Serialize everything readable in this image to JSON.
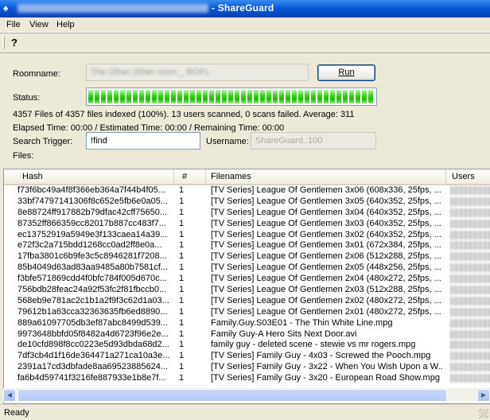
{
  "window": {
    "title": "- ShareGuard"
  },
  "menu": {
    "file": "File",
    "view": "View",
    "help": "Help"
  },
  "toolbar": {
    "help_glyph": "?"
  },
  "form": {
    "roomname_label": "Roomname:",
    "run_label": "Run",
    "status_label": "Status:",
    "progress": 1.0,
    "summary": "4357 Files of 4357 files indexed (100%). 13 users scanned, 0 scans failed. Average: 311",
    "elapsed": "Elapsed Time: 00:00 / Estimated Time: 00:00 / Remaining Time: 00:00",
    "search_trigger_label": "Search Trigger:",
    "search_trigger_value": "!find",
    "username_label": "Username:",
    "username_value": "ShareGuard..100",
    "files_label": "Files:"
  },
  "table": {
    "columns": [
      "Hash",
      "#",
      "Filenames",
      "Users"
    ],
    "rows": [
      {
        "hash": "f73f6bc49a4f8f366eb364a7f44b4f05...",
        "count": "1",
        "filename": "[TV Series] League Of Gentlemen 3x06 (608x336, 25fps, ..."
      },
      {
        "hash": "33bf74797141306f8c652e5fb6e0a05...",
        "count": "1",
        "filename": "[TV Series] League Of Gentlemen 3x05 (640x352, 25fps, ..."
      },
      {
        "hash": "8e88724ff917882b79dfac42cff75650...",
        "count": "1",
        "filename": "[TV Series] League Of Gentlemen 3x04 (640x352, 25fps, ..."
      },
      {
        "hash": "87352ff866359cc82017b887cc483f7...",
        "count": "1",
        "filename": "[TV Series] League Of Gentlemen 3x03 (640x352, 25fps, ..."
      },
      {
        "hash": "ec13752919a5949e3f133caea14a39...",
        "count": "1",
        "filename": "[TV Series] League Of Gentlemen 3x02 (640x352, 25fps, ..."
      },
      {
        "hash": "e72f3c2a715bdd1268cc0ad2ff8e0a...",
        "count": "1",
        "filename": "[TV Series] League Of Gentlemen 3x01 (672x384, 25fps, ..."
      },
      {
        "hash": "17fba3801c6b9fe3c5c8946281f7208...",
        "count": "1",
        "filename": "[TV Series] League Of Gentlemen 2x06 (512x288, 25fps, ..."
      },
      {
        "hash": "85b4049d63ad83aa9485a80b7581cf...",
        "count": "1",
        "filename": "[TV Series] League Of Gentlemen 2x05 (448x256, 25fps, ..."
      },
      {
        "hash": "f3bfe571869cdd4f0bfc784f005d670c...",
        "count": "1",
        "filename": "[TV Series] League Of Gentlemen 2x04 (480x272, 25fps, ..."
      },
      {
        "hash": "756bdb28feac24a92f53fc2f81fbccb0...",
        "count": "1",
        "filename": "[TV Series] League Of Gentlemen 2x03 (512x288, 25fps, ..."
      },
      {
        "hash": "568eb9e781ac2c1b1a2f9f3c62d1a03...",
        "count": "1",
        "filename": "[TV Series] League Of Gentlemen 2x02 (480x272, 25fps, ..."
      },
      {
        "hash": "79612b1a63cca32363635fb6ed8890...",
        "count": "1",
        "filename": "[TV Series] League Of Gentlemen 2x01 (480x272, 25fps, ..."
      },
      {
        "hash": "889a61097705db3ef87abc8499d539...",
        "count": "1",
        "filename": "Family.Guy.S03E01 - The Thin White Line.mpg"
      },
      {
        "hash": "9973648bbfd05f8482a4d6723f96e2e...",
        "count": "1",
        "filename": "Family Guy-A Hero Sits Next Door.avi"
      },
      {
        "hash": "de10cfd898f8cc0223e5d93dbda68d2...",
        "count": "1",
        "filename": "family guy - deleted scene - stewie vs mr rogers.mpg"
      },
      {
        "hash": "7df3cb4d1f16de364471a271ca10a3e...",
        "count": "1",
        "filename": "[TV Series] Family Guy - 4x03 - Screwed the Pooch.mpg"
      },
      {
        "hash": "2391a17cd3dbfade8aa69523885624...",
        "count": "1",
        "filename": "[TV Series] Family Guy - 3x22 - When You Wish Upon a W..."
      },
      {
        "hash": "fa6b4d59741f3216fe887933e1b8e7f...",
        "count": "1",
        "filename": "[TV Series] Family Guy - 3x20 - European Road Show.mpg"
      }
    ]
  },
  "statusbar": {
    "text": "Ready"
  },
  "colors": {
    "titlebar": "#0a5ad6",
    "progress_green": "#37d017",
    "face": "#ece9d8"
  }
}
